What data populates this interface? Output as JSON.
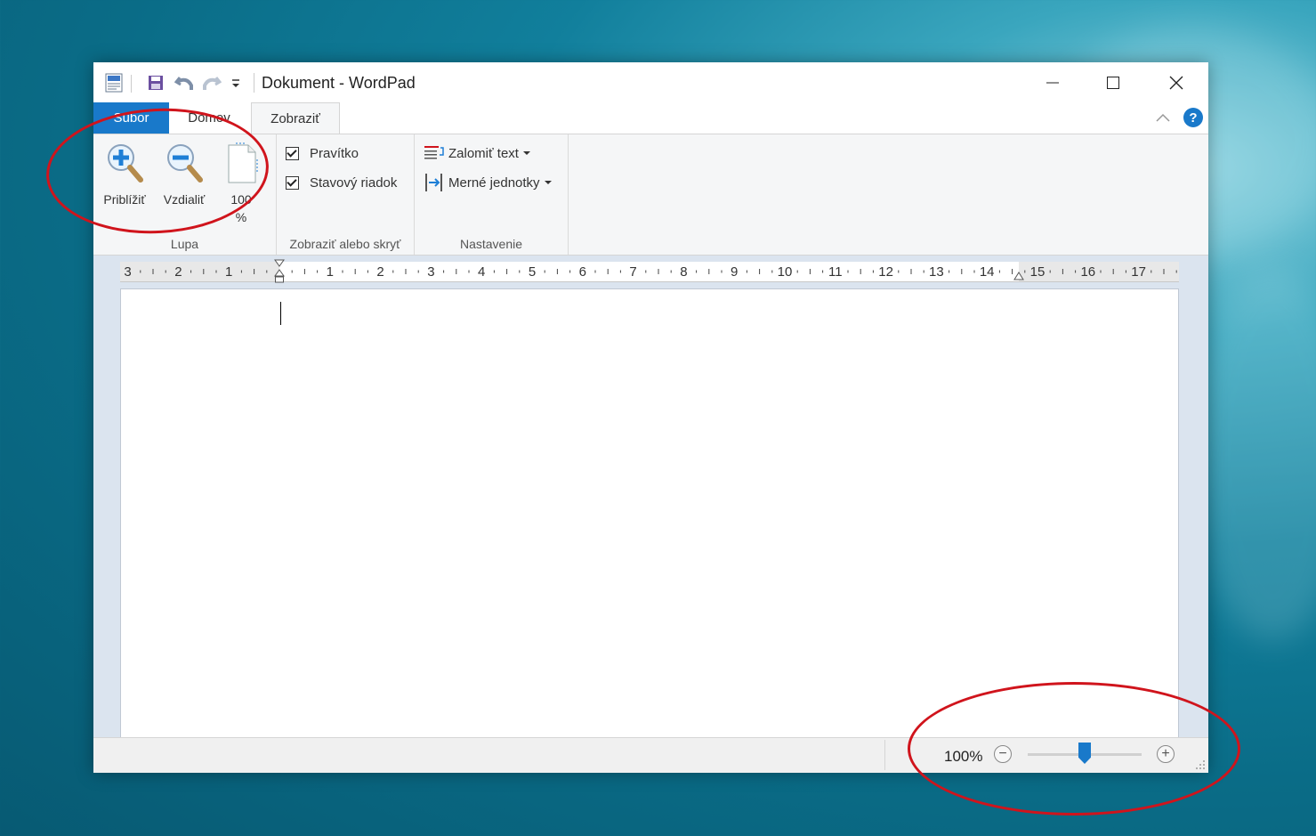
{
  "window": {
    "title": "Dokument - WordPad"
  },
  "tabs": [
    {
      "label": "Súbor"
    },
    {
      "label": "Domov"
    },
    {
      "label": "Zobraziť"
    }
  ],
  "ribbon": {
    "zoom_group": {
      "label": "Lupa",
      "zoom_in": "Priblížiť",
      "zoom_out": "Vzdialiť",
      "hundred": "100",
      "hundred_pct": "%"
    },
    "show_hide_group": {
      "label": "Zobraziť alebo skryť",
      "ruler": {
        "label": "Pravítko",
        "checked": true
      },
      "statusbar": {
        "label": "Stavový riadok",
        "checked": true
      }
    },
    "settings_group": {
      "label": "Nastavenie",
      "word_wrap": "Zalomiť text",
      "units": "Merné jednotky"
    }
  },
  "ruler": {
    "ticks": [
      "3",
      "2",
      "1",
      "1",
      "2",
      "3",
      "4",
      "5",
      "6",
      "7",
      "8",
      "9",
      "10",
      "11",
      "12",
      "13",
      "14",
      "15",
      "16",
      "17"
    ]
  },
  "statusbar": {
    "zoom": "100%",
    "zoom_level": 0.5
  },
  "icons": {
    "app": "wordpad-app-icon",
    "save": "save-icon",
    "undo": "undo-icon",
    "redo": "redo-icon",
    "customize": "qat-dropdown-icon",
    "help": "help-icon"
  },
  "colors": {
    "accent": "#1979ca",
    "annotation": "#d0141c"
  }
}
